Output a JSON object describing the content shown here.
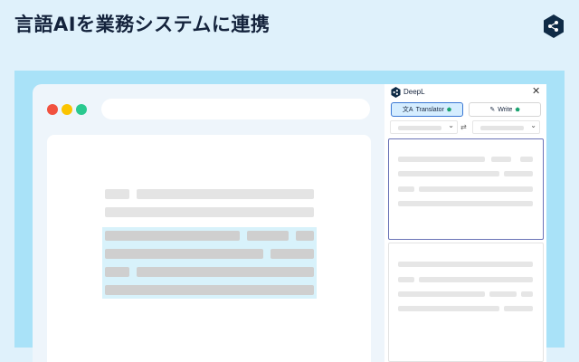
{
  "banner": {
    "headline": "言語AIを業務システムに連携",
    "logo_icon": "deepl-logo-icon",
    "accent_color": "#0f2b46"
  },
  "browser": {
    "window_controls": [
      "close",
      "minimize",
      "maximize"
    ],
    "control_colors": [
      "#f1513f",
      "#fbc400",
      "#29c98f"
    ],
    "highlight_color": "#d8f2fb"
  },
  "panel": {
    "app_name": "DeepL",
    "close_icon": "close-icon",
    "tabs": [
      {
        "label": "Translator",
        "icon": "translate-icon",
        "active": true
      },
      {
        "label": "Write",
        "icon": "magic-wand-icon",
        "active": false
      }
    ],
    "swap_icon": "language-swap-icon",
    "active_tab_color": "#d5edff",
    "source_border_color": "#6a73b7"
  }
}
